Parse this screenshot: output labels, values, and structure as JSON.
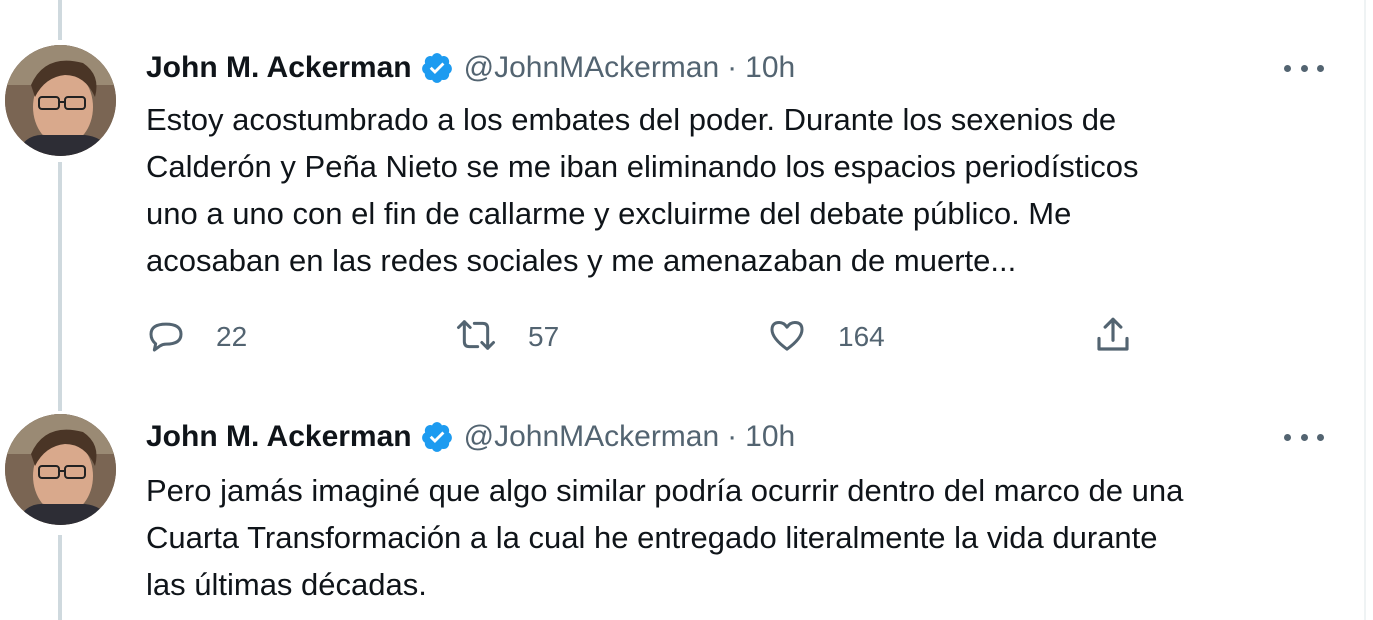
{
  "tweets": [
    {
      "author_name": "John M. Ackerman",
      "handle": "@JohnMAckerman",
      "separator": "·",
      "time": "10h",
      "text": "Estoy acostumbrado a los embates del poder. Durante los sexenios de\nCalderón y Peña Nieto se me iban eliminando los espacios periodísticos\nuno a uno con el fin de callarme y excluirme del debate público. Me\nacosaban en las redes sociales y me amenazaban de muerte...",
      "replies": "22",
      "retweets": "57",
      "likes": "164"
    },
    {
      "author_name": "John M. Ackerman",
      "handle": "@JohnMAckerman",
      "separator": "·",
      "time": "10h",
      "text": "Pero jamás imaginé que algo similar podría ocurrir dentro del marco de una\nCuarta Transformación a la cual he entregado literalmente la vida durante\nlas últimas décadas."
    }
  ],
  "icons": {
    "verified": "verified-badge-icon",
    "more": "more-horizontal-icon",
    "reply": "reply-icon",
    "retweet": "retweet-icon",
    "like": "like-heart-icon",
    "share": "share-icon"
  },
  "colors": {
    "verified": "#1d9bf0",
    "secondary_text": "#536471",
    "thread_line": "#cfd9de"
  }
}
